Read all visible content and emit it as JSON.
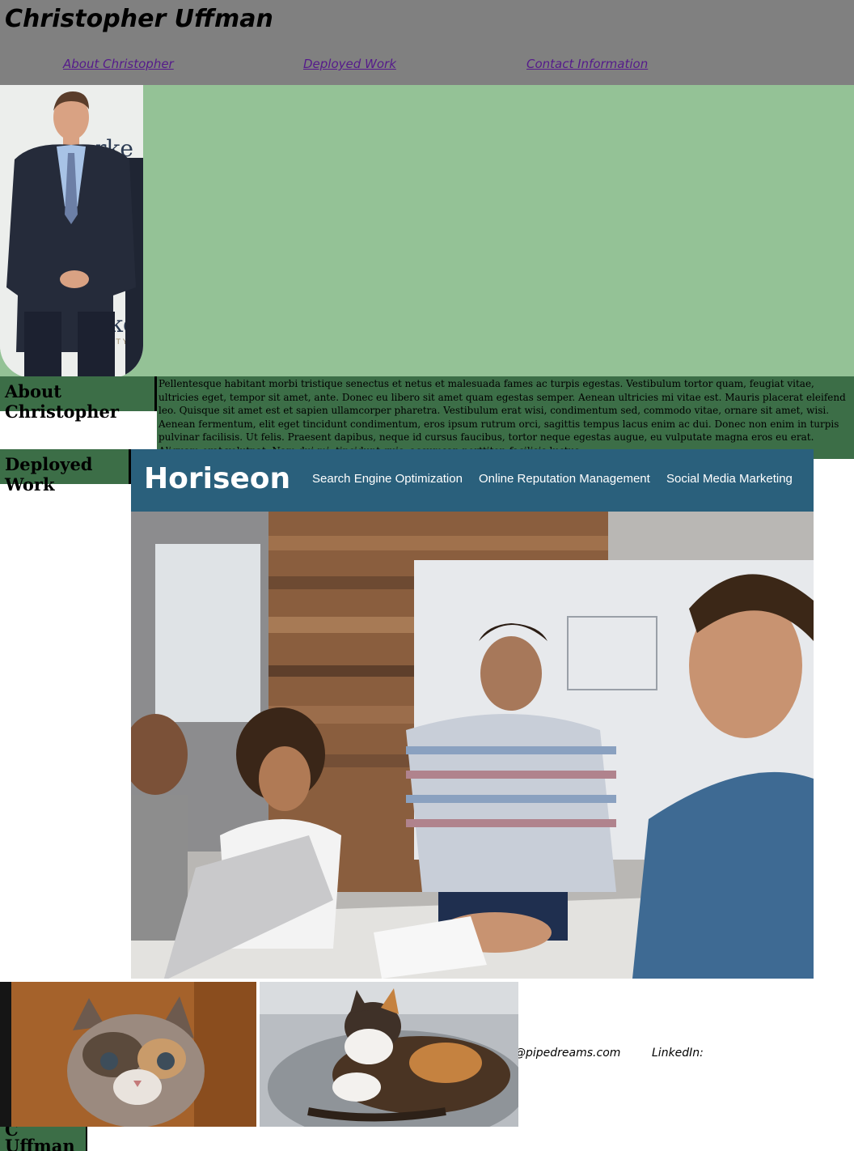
{
  "header": {
    "title": "Christopher Uffman",
    "nav": [
      "About Christopher",
      "Deployed Work",
      "Contact Information"
    ]
  },
  "about": {
    "heading": "About Christopher",
    "text": "Pellentesque habitant morbi tristique senectus et netus et malesuada fames ac turpis egestas. Vestibulum tortor quam, feugiat vitae, ultricies eget, tempor sit amet, ante. Donec eu libero sit amet quam egestas semper. Aenean ultricies mi vitae est. Mauris placerat eleifend leo. Quisque sit amet est et sapien ullamcorper pharetra. Vestibulum erat wisi, condimentum sed, commodo vitae, ornare sit amet, wisi. Aenean fermentum, elit eget tincidunt condimentum, eros ipsum rutrum orci, sagittis tempus lacus enim ac dui. Donec non enim in turpis pulvinar facilisis. Ut felis. Praesent dapibus, neque id cursus faucibus, tortor neque egestas augue, eu vulputate magna eros eu erat. Aliquam erat volutpat. Nam dui mi, tincidunt quis, accumsan porttitor, facilisis luctus"
  },
  "work": {
    "heading": "Deployed Work",
    "project": {
      "logo": "Horiseon",
      "nav": [
        "Search Engine Optimization",
        "Online Reputation Management",
        "Social Media Marketing"
      ]
    }
  },
  "contact": {
    "email_fragment": "@pipedreams.com",
    "linkedin_label": "LinkedIn:"
  },
  "footer": {
    "name": "C Uffman"
  },
  "colors": {
    "header_bg": "#808080",
    "hero_bg": "#94c296",
    "section_bg": "#3c6e47",
    "project_bar": "#2a607c",
    "link": "#551a8b"
  }
}
